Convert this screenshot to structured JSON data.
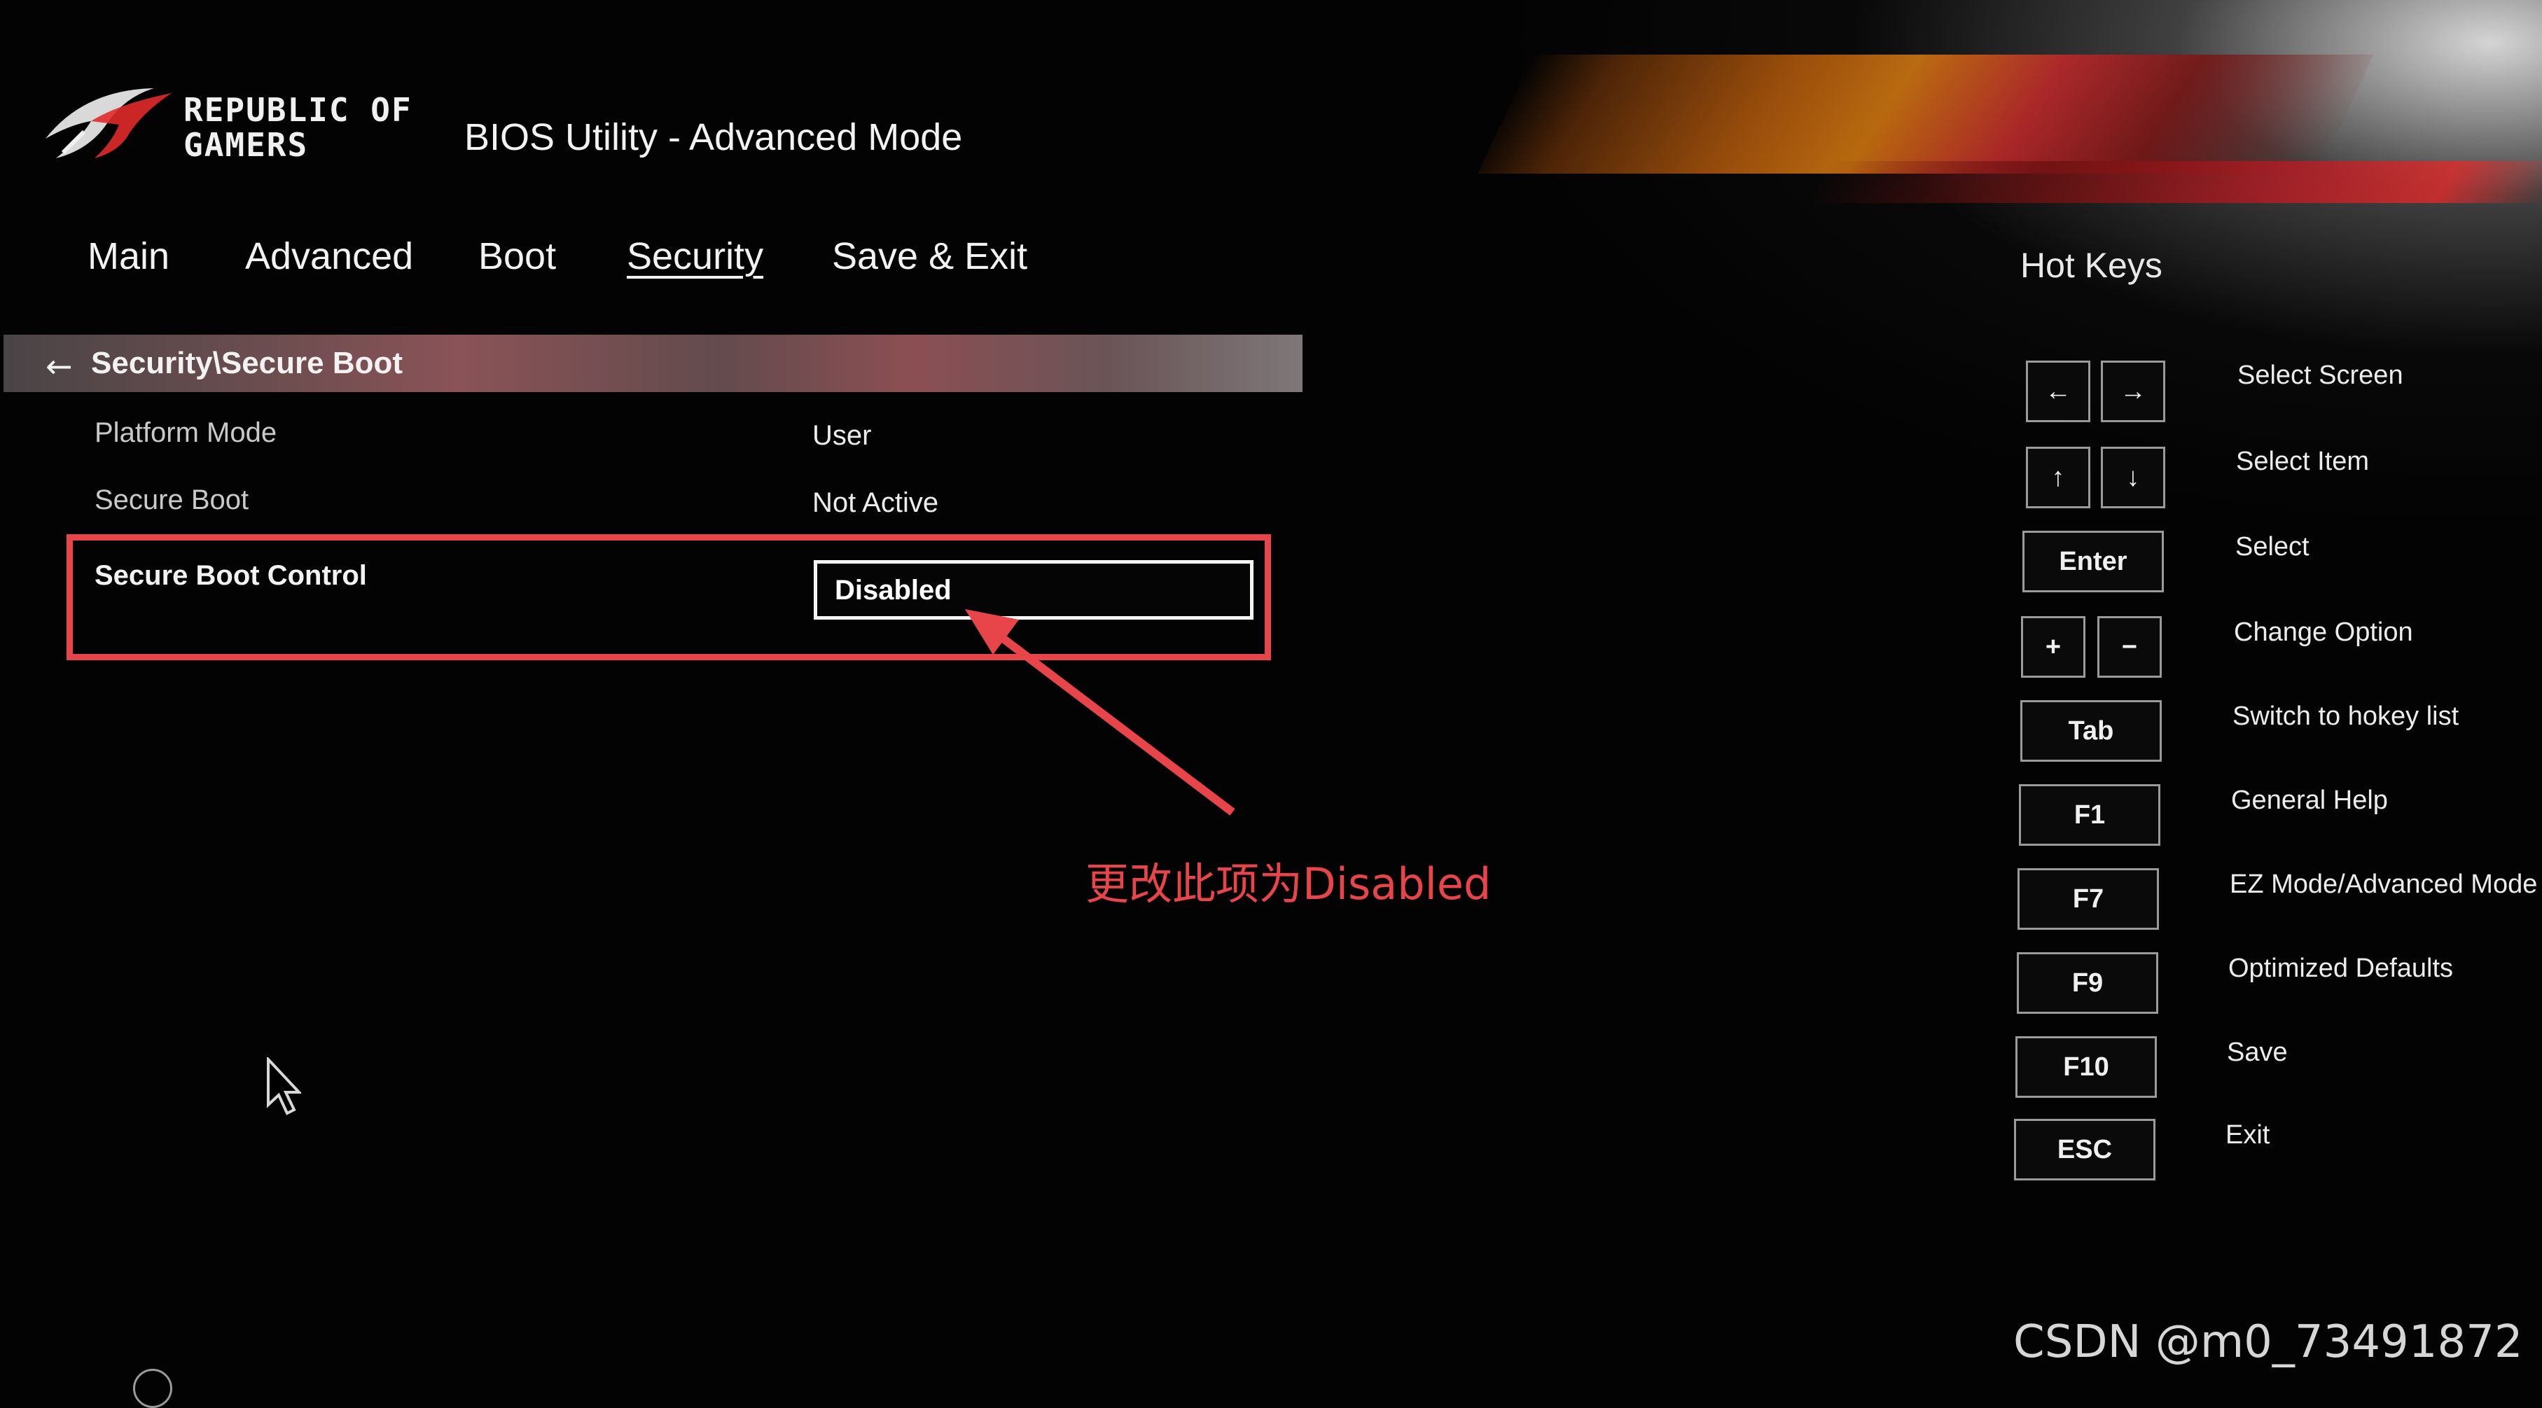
{
  "header": {
    "logo_text_line1": "REPUBLIC OF",
    "logo_text_line2": "GAMERS",
    "title": "BIOS Utility - Advanced Mode"
  },
  "nav": {
    "tabs": [
      {
        "label": "Main"
      },
      {
        "label": "Advanced"
      },
      {
        "label": "Boot"
      },
      {
        "label": "Security",
        "active": true
      },
      {
        "label": "Save & Exit"
      }
    ]
  },
  "breadcrumb": {
    "back_icon": "arrow-left-icon",
    "path": "Security\\Secure Boot"
  },
  "settings": [
    {
      "label": "Platform Mode",
      "value": "User"
    },
    {
      "label": "Secure Boot",
      "value": "Not Active"
    },
    {
      "label": "Secure Boot Control",
      "value": "Disabled",
      "control": "select"
    }
  ],
  "annotation": {
    "text": "更改此项为Disabled",
    "color": "#e8454a"
  },
  "hotkeys": {
    "title": "Hot Keys",
    "items": [
      {
        "keys": [
          "←",
          "→"
        ],
        "label": "Select Screen"
      },
      {
        "keys": [
          "↑",
          "↓"
        ],
        "label": "Select Item"
      },
      {
        "keys": [
          "Enter"
        ],
        "label": "Select"
      },
      {
        "keys": [
          "+",
          "−"
        ],
        "label": "Change Option"
      },
      {
        "keys": [
          "Tab"
        ],
        "label": "Switch to hokey list"
      },
      {
        "keys": [
          "F1"
        ],
        "label": "General Help"
      },
      {
        "keys": [
          "F7"
        ],
        "label": "EZ Mode/Advanced Mode"
      },
      {
        "keys": [
          "F9"
        ],
        "label": "Optimized Defaults"
      },
      {
        "keys": [
          "F10"
        ],
        "label": "Save"
      },
      {
        "keys": [
          "ESC"
        ],
        "label": "Exit"
      }
    ]
  },
  "watermark": "CSDN @m0_73491872",
  "colors": {
    "accent_red": "#e8454a",
    "background": "#030303"
  }
}
